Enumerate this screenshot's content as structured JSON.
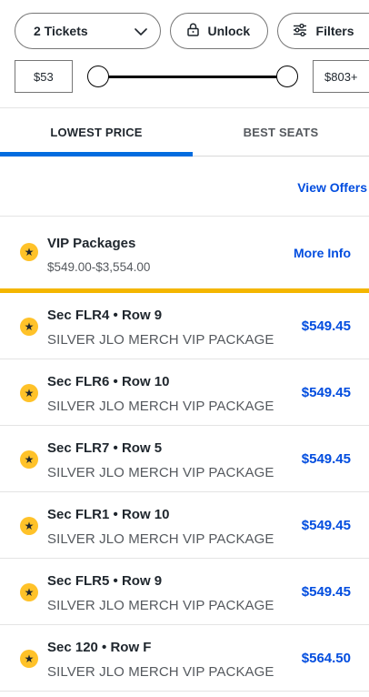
{
  "filters": {
    "tickets_label": "2 Tickets",
    "unlock_label": "Unlock",
    "filters_label": "Filters"
  },
  "price_range": {
    "min_label": "$53",
    "max_label": "$803+"
  },
  "tabs": [
    {
      "label": "LOWEST PRICE",
      "active": true
    },
    {
      "label": "BEST SEATS",
      "active": false
    }
  ],
  "view_offers_label": "View Offers",
  "vip": {
    "title": "VIP Packages",
    "range": "$549.00-$3,554.00",
    "more_info_label": "More Info"
  },
  "listings": [
    {
      "section": "Sec FLR4 • Row 9",
      "description": "SILVER JLO MERCH VIP PACKAGE",
      "price": "$549.45"
    },
    {
      "section": "Sec FLR6 • Row 10",
      "description": "SILVER JLO MERCH VIP PACKAGE",
      "price": "$549.45"
    },
    {
      "section": "Sec FLR7 • Row 5",
      "description": "SILVER JLO MERCH VIP PACKAGE",
      "price": "$549.45"
    },
    {
      "section": "Sec FLR1 • Row 10",
      "description": "SILVER JLO MERCH VIP PACKAGE",
      "price": "$549.45"
    },
    {
      "section": "Sec FLR5 • Row 9",
      "description": "SILVER JLO MERCH VIP PACKAGE",
      "price": "$549.45"
    },
    {
      "section": "Sec 120 • Row F",
      "description": "SILVER JLO MERCH VIP PACKAGE",
      "price": "$564.50"
    }
  ],
  "colors": {
    "accent_blue": "#026cdf",
    "link_blue": "#024ddf",
    "star_yellow": "#ffc229",
    "gold_divider": "#f4b600"
  }
}
